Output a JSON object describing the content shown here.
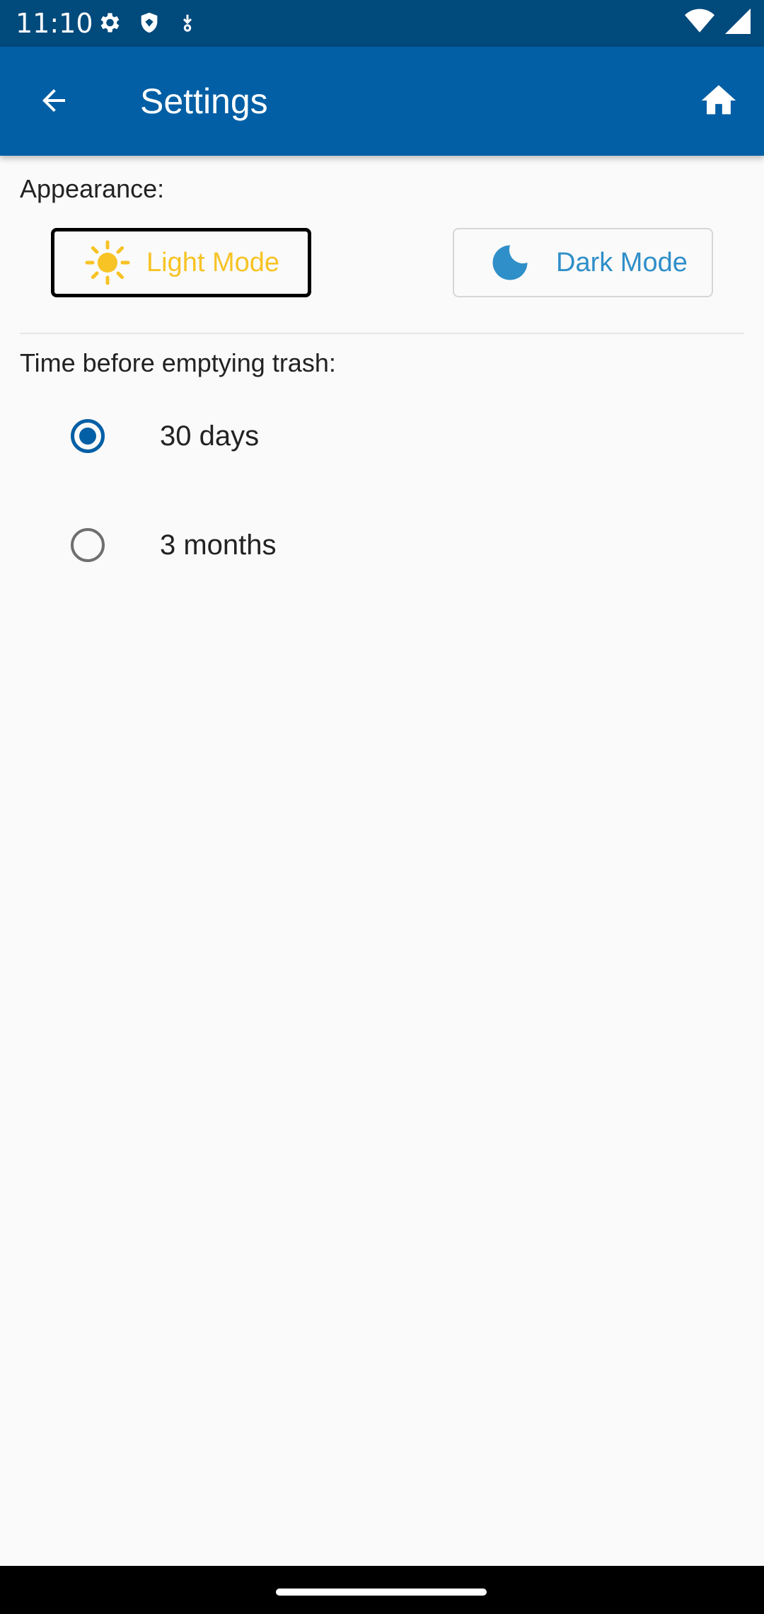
{
  "status_bar": {
    "time": "11:10",
    "icons_left": [
      "settings-icon",
      "shield-icon",
      "download-icon"
    ],
    "icons_right": [
      "wifi-icon",
      "signal-icon"
    ]
  },
  "app_bar": {
    "title": "Settings",
    "back_icon": "arrow-back-icon",
    "home_icon": "home-icon",
    "background": "#035fa5"
  },
  "appearance": {
    "label": "Appearance:",
    "light_mode_label": "Light Mode",
    "dark_mode_label": "Dark Mode",
    "selected": "Light Mode",
    "light_color": "#f7c325",
    "dark_color": "#2f8fc8"
  },
  "trash": {
    "label": "Time before emptying trash:",
    "options": [
      {
        "label": "30 days",
        "checked": true
      },
      {
        "label": "3 months",
        "checked": false
      }
    ]
  }
}
